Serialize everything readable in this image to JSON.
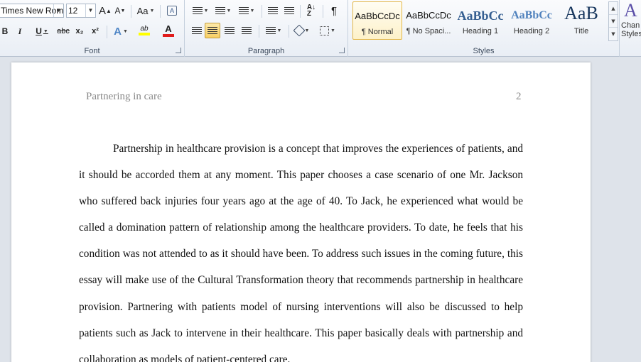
{
  "ribbon": {
    "font_group": {
      "label": "Font",
      "font_name": "Times New Rom",
      "font_size": "12",
      "grow_glyph": "A",
      "shrink_glyph": "A",
      "case_glyph": "Aa",
      "clear_glyph": "A",
      "bold": "B",
      "italic": "I",
      "underline": "U",
      "strike": "abc",
      "subscript": "x₂",
      "superscript": "x²",
      "effects_glyph": "A",
      "highlight_glyph": "ab",
      "color_glyph": "A"
    },
    "paragraph_group": {
      "label": "Paragraph",
      "pilcrow": "¶"
    },
    "styles_group": {
      "label": "Styles",
      "tiles": [
        {
          "sample": "AaBbCcDc",
          "name": "¶ Normal"
        },
        {
          "sample": "AaBbCcDc",
          "name": "¶ No Spaci..."
        },
        {
          "sample": "AaBbCc",
          "name": "Heading 1"
        },
        {
          "sample": "AaBbCc",
          "name": "Heading 2"
        },
        {
          "sample": "AaB",
          "name": "Title"
        }
      ],
      "change_styles_line1": "Chan",
      "change_styles_line2": "Styles"
    },
    "colors": {
      "highlight": "#ffff00",
      "font_color": "#e01b1b",
      "heading": "#365f91",
      "title": "#17365d"
    }
  },
  "document": {
    "header_title": "Partnering in care",
    "page_number": "2",
    "paragraph": "Partnership in healthcare provision is a concept that improves the experiences of patients, and it should be accorded them at any moment. This paper chooses a case scenario of one Mr. Jackson who suffered back injuries four years ago at the age of 40. To Jack, he experienced what would be called a domination pattern of relationship among the healthcare providers. To date, he feels that his condition was not attended to as it should have been. To address such issues in the coming future, this essay will make use of the Cultural Transformation theory that recommends partnership in healthcare provision. Partnering with patients model of nursing interventions will also be discussed to help patients such as Jack to intervene in their healthcare. This paper basically deals with partnership and collaboration as models of patient-centered care."
  }
}
